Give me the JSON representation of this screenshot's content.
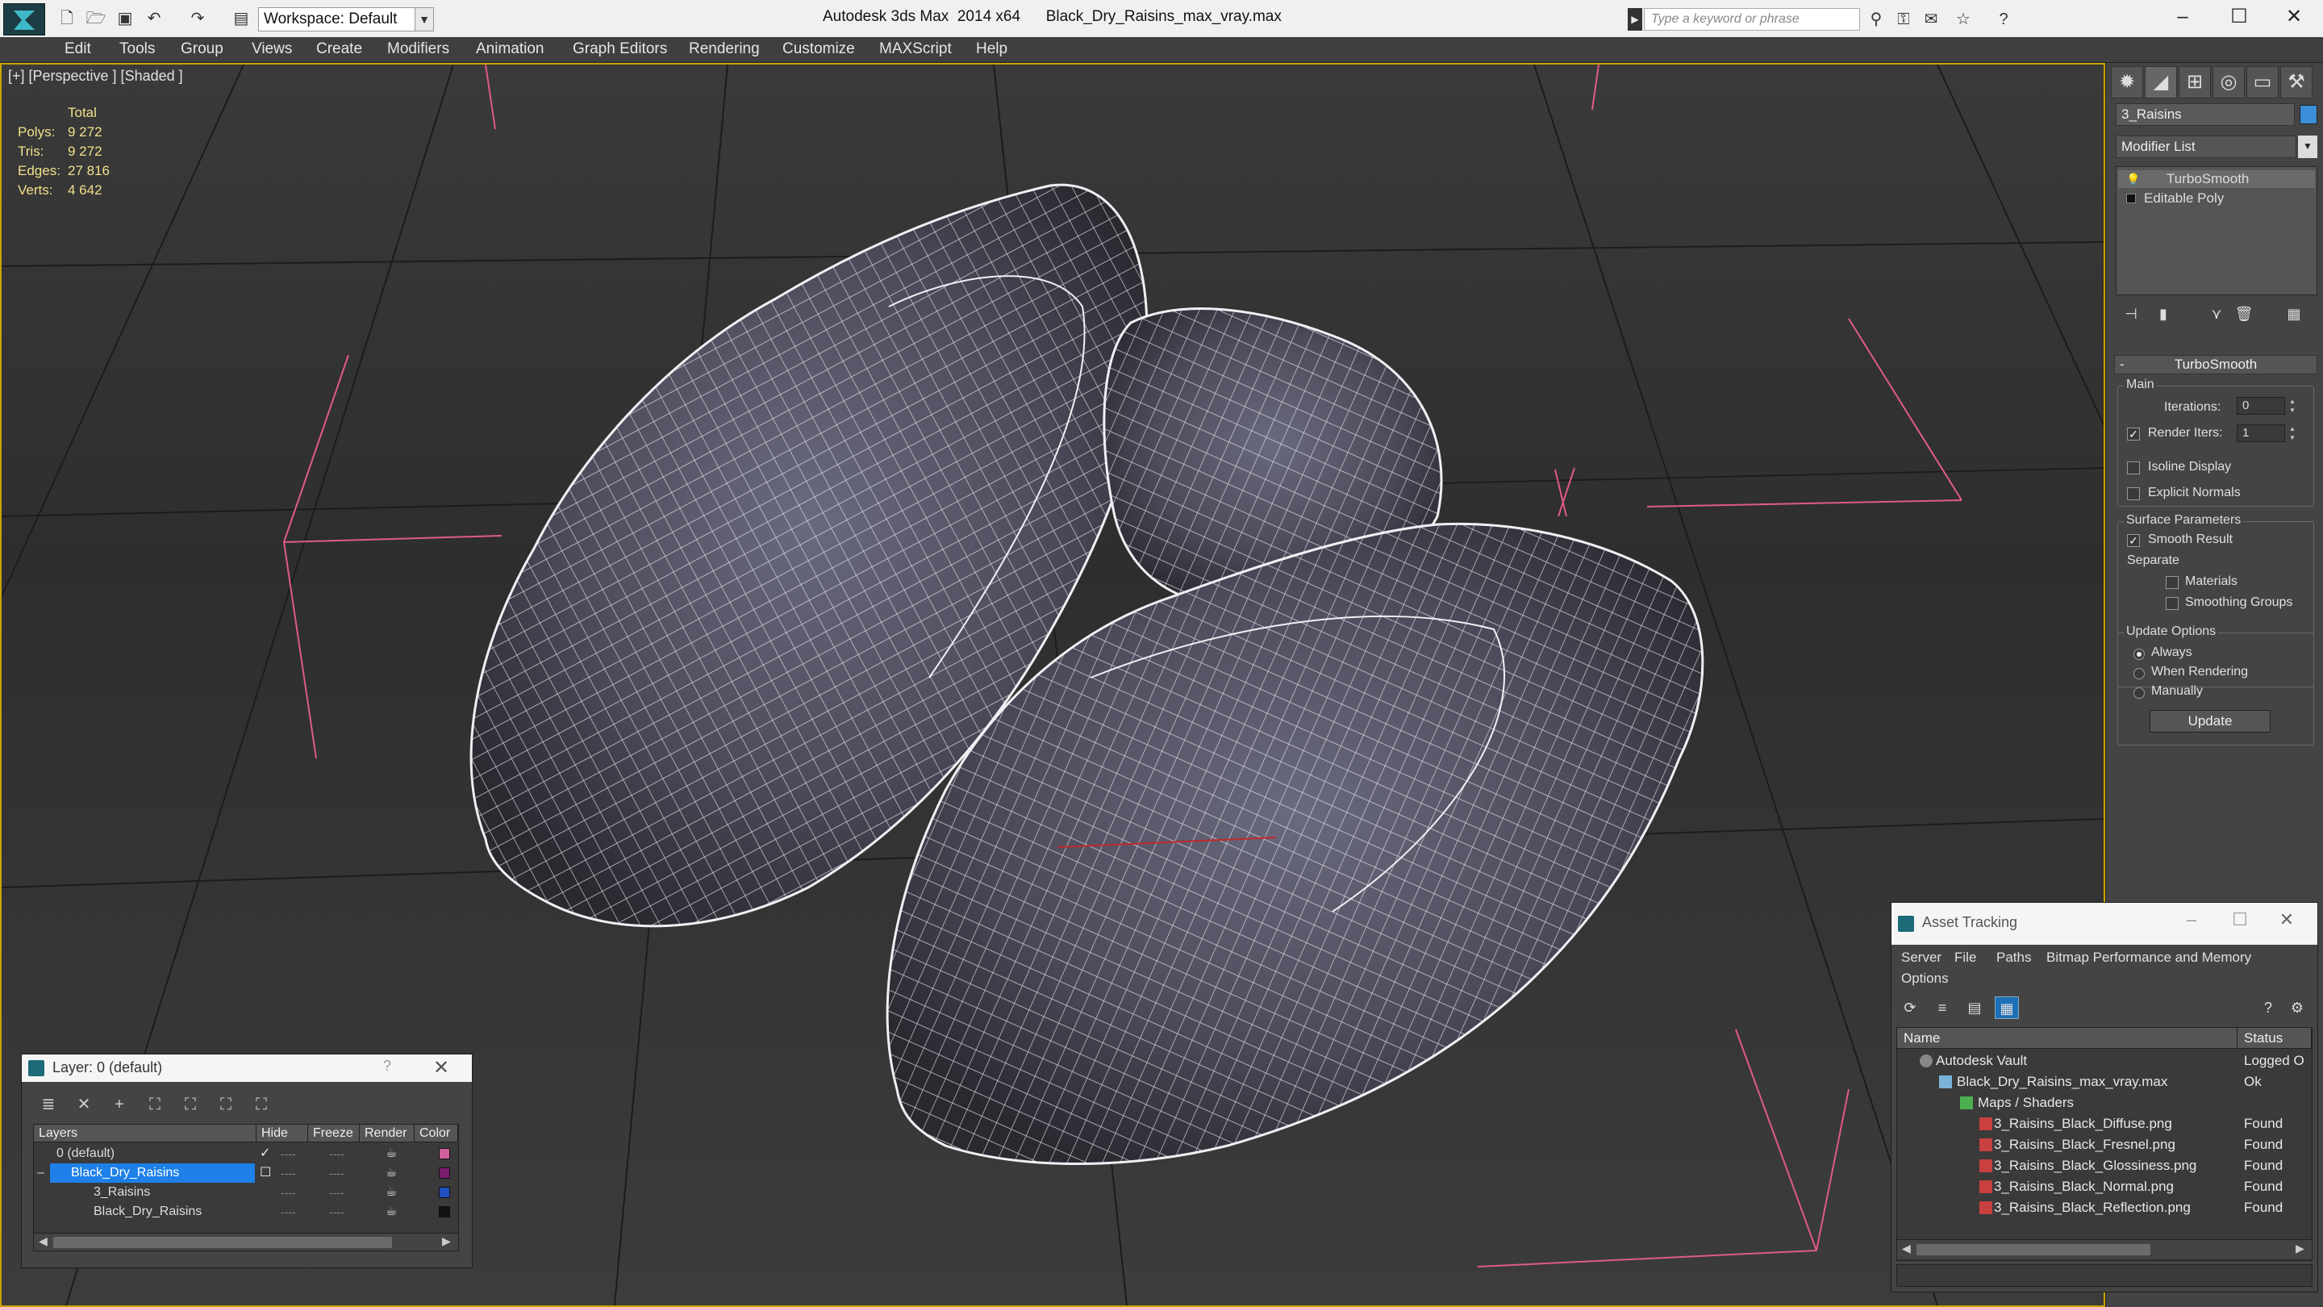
{
  "titlebar": {
    "app_title": "Autodesk 3ds Max  2014 x64",
    "file_title": "Black_Dry_Raisins_max_vray.max",
    "workspace_label": "Workspace: Default",
    "search_placeholder": "Type a keyword or phrase",
    "minimize": "–",
    "maximize": "☐",
    "close": "✕"
  },
  "menu": {
    "items": [
      "Edit",
      "Tools",
      "Group",
      "Views",
      "Create",
      "Modifiers",
      "Animation",
      "Graph Editors",
      "Rendering",
      "Customize",
      "MAXScript",
      "Help"
    ]
  },
  "viewport": {
    "label": "[+] [Perspective ] [Shaded ]",
    "stats": {
      "total_label": "Total",
      "rows": [
        {
          "key": "Polys:",
          "value": "9 272"
        },
        {
          "key": "Tris:",
          "value": "9 272"
        },
        {
          "key": "Edges:",
          "value": "27 816"
        },
        {
          "key": "Verts:",
          "value": "4 642"
        }
      ]
    }
  },
  "command_panel": {
    "object_name": "3_Raisins",
    "object_color": "#3b8ed8",
    "modifier_list": "Modifier List",
    "stack": [
      "TurboSmooth",
      "Editable Poly"
    ],
    "rollout_title": "TurboSmooth",
    "main_group": "Main",
    "iterations_label": "Iterations:",
    "iterations_value": "0",
    "render_iters_label": "Render Iters:",
    "render_iters_value": "1",
    "render_iters_checked": "✓",
    "isoline_label": "Isoline Display",
    "explicit_normals_label": "Explicit Normals",
    "surface_group": "Surface Parameters",
    "smooth_result_label": "Smooth Result",
    "smooth_result_checked": "✓",
    "separate_label": "Separate",
    "materials_label": "Materials",
    "smoothing_groups_label": "Smoothing Groups",
    "update_group": "Update Options",
    "always_label": "Always",
    "when_rendering_label": "When Rendering",
    "manually_label": "Manually",
    "update_button": "Update"
  },
  "layer_dialog": {
    "title": "Layer: 0 (default)",
    "help": "?",
    "close": "✕",
    "columns": [
      "Layers",
      "Hide",
      "Freeze",
      "Render",
      "Color"
    ],
    "rows": [
      {
        "name": "0 (default)",
        "hide": "----",
        "freeze": "----",
        "color": "#d0609a",
        "check": "✓"
      },
      {
        "name": "Black_Dry_Raisins",
        "hide": "----",
        "freeze": "----",
        "color": "#7a1c6e",
        "check": "☐"
      },
      {
        "name": "3_Raisins",
        "hide": "----",
        "freeze": "----",
        "color": "#2050c0",
        "check": ""
      },
      {
        "name": "Black_Dry_Raisins",
        "hide": "----",
        "freeze": "----",
        "color": "#111111",
        "check": ""
      }
    ]
  },
  "asset_tracking": {
    "title": "Asset Tracking",
    "menu": [
      "Server",
      "File",
      "Paths",
      "Bitmap Performance and Memory",
      "Options"
    ],
    "columns": [
      "Name",
      "Status"
    ],
    "rows": [
      {
        "name": "Autodesk Vault",
        "status": "Logged O"
      },
      {
        "name": "Black_Dry_Raisins_max_vray.max",
        "status": "Ok"
      },
      {
        "name": "Maps / Shaders",
        "status": ""
      },
      {
        "name": "3_Raisins_Black_Diffuse.png",
        "status": "Found"
      },
      {
        "name": "3_Raisins_Black_Fresnel.png",
        "status": "Found"
      },
      {
        "name": "3_Raisins_Black_Glossiness.png",
        "status": "Found"
      },
      {
        "name": "3_Raisins_Black_Normal.png",
        "status": "Found"
      },
      {
        "name": "3_Raisins_Black_Reflection.png",
        "status": "Found"
      }
    ]
  }
}
